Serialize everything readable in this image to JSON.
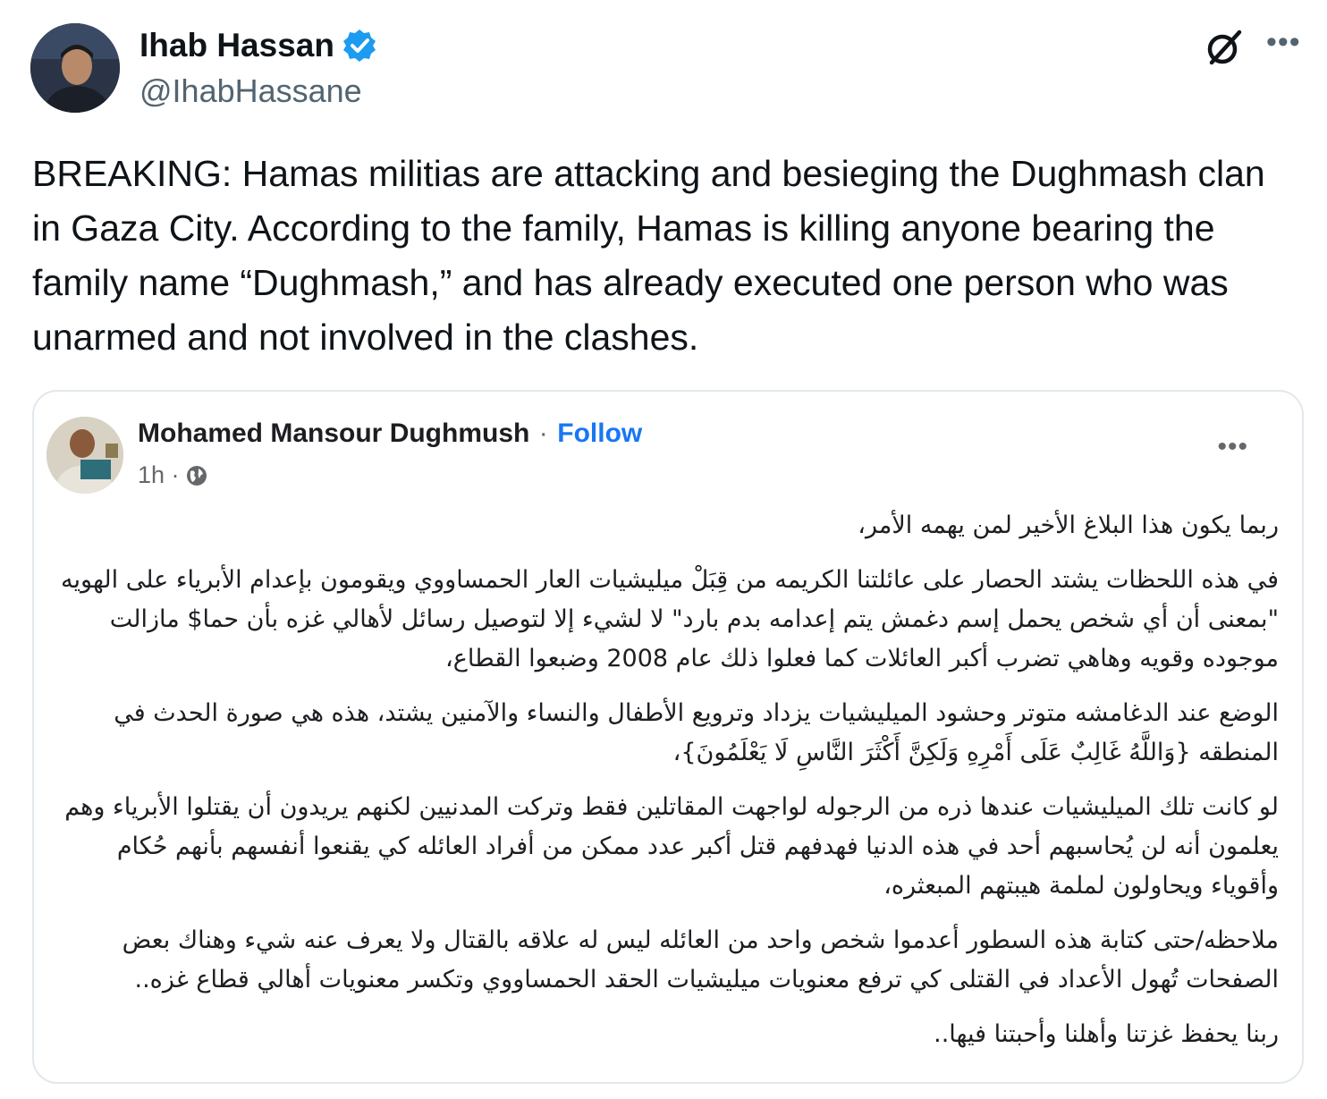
{
  "tweet": {
    "author_name": "Ihab Hassan",
    "author_handle": "@IhabHassane",
    "text": "BREAKING: Hamas militias are attacking and besieging the Dughmash clan in Gaza City. According to the family, Hamas is killing anyone bearing the family name “Dughmash,” and has already executed one person who was unarmed and not involved in the clashes.",
    "icons": [
      "verified-badge-icon",
      "grok-icon",
      "more-options-icon"
    ]
  },
  "quoted_post": {
    "author_name": "Mohamed Mansour Dughmush",
    "separator": "·",
    "follow_label": "Follow",
    "time": "1h ·",
    "paragraphs": [
      "ربما يكون هذا البلاغ الأخير لمن يهمه الأمر،",
      "في هذه اللحظات يشتد الحصار على عائلتنا الكريمه من قِبَلْ ميليشيات العار الحمساووي ويقومون بإعدام الأبرياء على الهويه \"بمعنى أن أي شخص يحمل إسم دغمش يتم إعدامه بدم بارد\" لا لشيء إلا لتوصيل رسائل لأهالي غزه بأن حما$ مازالت موجوده وقويه وهاهي تضرب أكبر العائلات كما فعلوا ذلك عام 2008 وضبعوا القطاع،",
      "الوضع عند الدغامشه متوتر وحشود الميليشيات يزداد وترويع الأطفال والنساء والآمنين يشتد، هذه هي صورة الحدث في المنطقه {وَاللَّهُ غَالِبٌ عَلَى أَمْرِهِ وَلَكِنَّ أَكْثَرَ النَّاسِ لَا يَعْلَمُونَ}،",
      "لو كانت تلك الميليشيات عندها ذره من الرجوله لواجهت المقاتلين فقط وتركت المدنيين لكنهم يريدون أن يقتلوا الأبرياء وهم يعلمون أنه لن يُحاسبهم أحد في هذه الدنيا فهدفهم قتل أكبر عدد ممكن من أفراد العائله كي يقنعوا أنفسهم بأنهم حُكام وأقوياء ويحاولون لملمة هيبتهم المبعثره،",
      "ملاحظه/حتى كتابة هذه السطور أعدموا شخص واحد من العائله ليس له علاقه بالقتال ولا يعرف عنه شيء وهناك بعض الصفحات تُهول الأعداد في القتلى كي ترفع معنويات ميليشيات الحقد الحمساووي وتكسر معنويات أهالي قطاع غزه..",
      "ربنا يحفظ غزتنا وأهلنا وأحبتنا فيها.."
    ],
    "icons": [
      "globe-icon",
      "more-options-icon"
    ],
    "colors": {
      "follow": "#1877f2",
      "meta": "#65676b"
    }
  }
}
